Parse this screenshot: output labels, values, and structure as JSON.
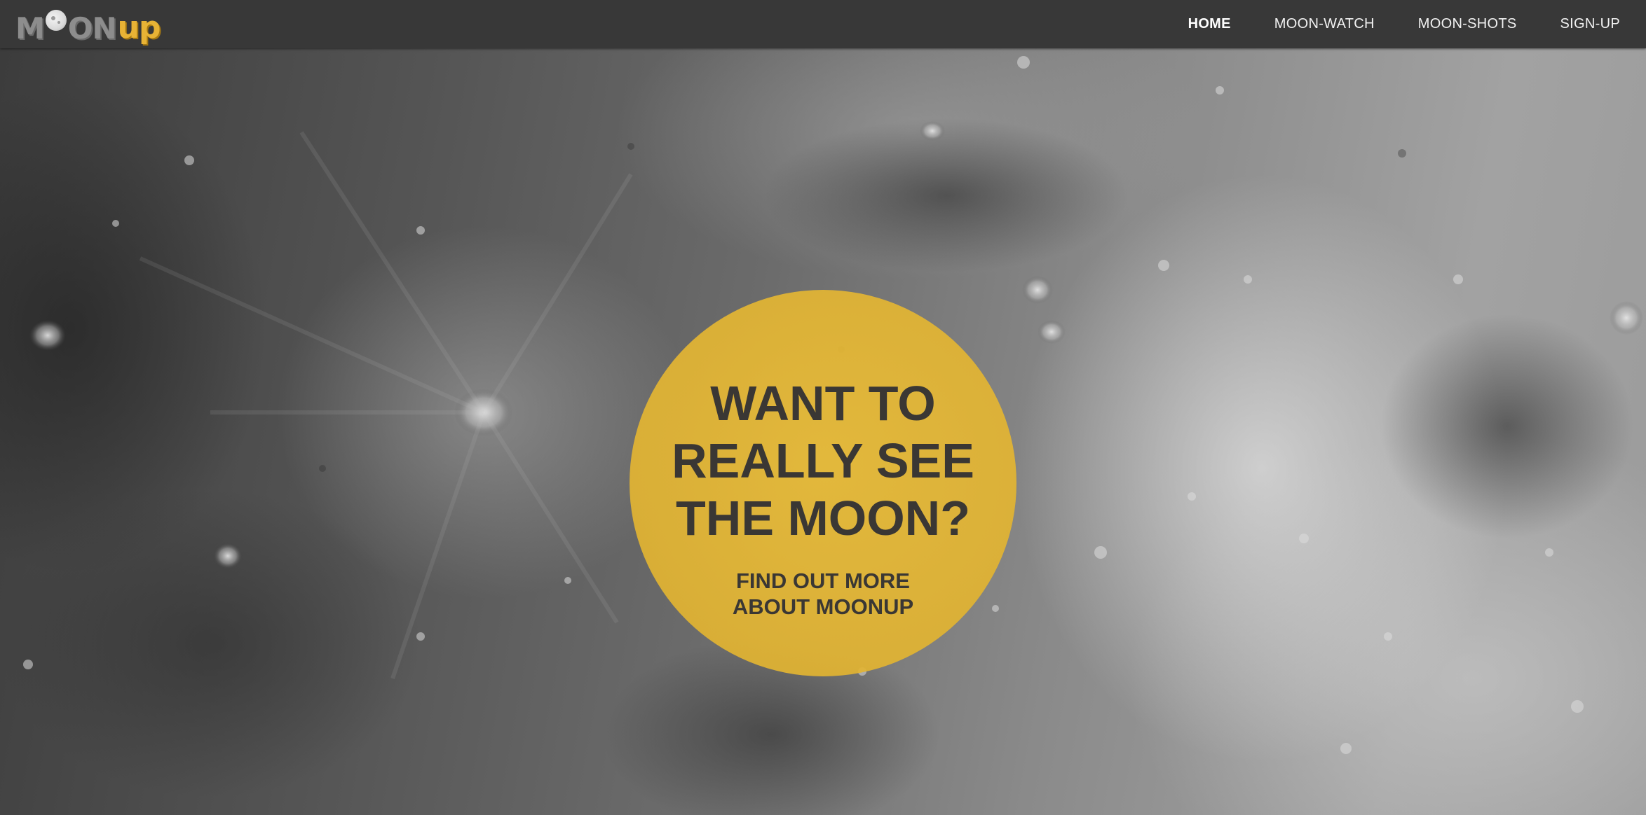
{
  "logo": {
    "part_moon_left": "M",
    "part_moon_right": "ON",
    "part_up": "up"
  },
  "nav": {
    "items": [
      {
        "label": "HOME",
        "active": true
      },
      {
        "label": "MOON-WATCH",
        "active": false
      },
      {
        "label": "MOON-SHOTS",
        "active": false
      },
      {
        "label": "SIGN-UP",
        "active": false
      }
    ]
  },
  "hero": {
    "background": "moon-surface-photo",
    "headline": "WANT TO REALLY SEE THE MOON?",
    "cta_link": "FIND OUT MORE ABOUT MOONUP"
  },
  "colors": {
    "navbar": "#383838",
    "accent_yellow": "#e2b337",
    "circle_text": "#3a3734",
    "nav_text": "#f2f2f2"
  }
}
